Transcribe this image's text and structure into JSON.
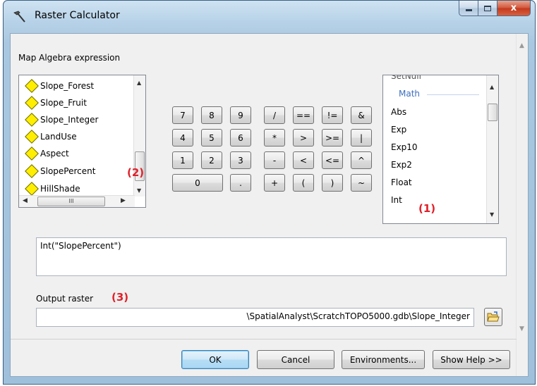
{
  "window": {
    "title": "Raster Calculator",
    "close_glyph": "x",
    "maximize_glyph": "□"
  },
  "expression_section": {
    "label": "Map Algebra expression"
  },
  "layers": {
    "items": [
      "Slope_Forest",
      "Slope_Fruit",
      "Slope_Integer",
      "LandUse",
      "Aspect",
      "SlopePercent",
      "HillShade"
    ],
    "hscroll_thumb_glyph": "III"
  },
  "calculator": {
    "buttons": [
      [
        "7",
        "8",
        "9",
        "/",
        "==",
        "!=",
        "&"
      ],
      [
        "4",
        "5",
        "6",
        "*",
        ">",
        ">=",
        "|"
      ],
      [
        "1",
        "2",
        "3",
        "-",
        "<",
        "<=",
        "^"
      ],
      [
        "0",
        ".",
        "+",
        "(",
        ")",
        "~"
      ]
    ]
  },
  "functions": {
    "partial_top": "SetNull",
    "category": "Math",
    "items": [
      "Abs",
      "Exp",
      "Exp10",
      "Exp2",
      "Float",
      "Int"
    ]
  },
  "annotations": {
    "note1": "(1)",
    "note2": "(2)",
    "note3": "(3)"
  },
  "expression": {
    "value": "Int(\"SlopePercent\")"
  },
  "output": {
    "label": "Output raster",
    "value": "\\SpatialAnalyst\\ScratchTOPO5000.gdb\\Slope_Integer"
  },
  "buttons": {
    "ok": "OK",
    "cancel": "Cancel",
    "environments": "Environments...",
    "show_help": "Show Help >>"
  },
  "colors": {
    "annotation_red": "#e0202a",
    "category_blue": "#3b6fbf",
    "layer_icon_yellow": "#ffee00"
  }
}
